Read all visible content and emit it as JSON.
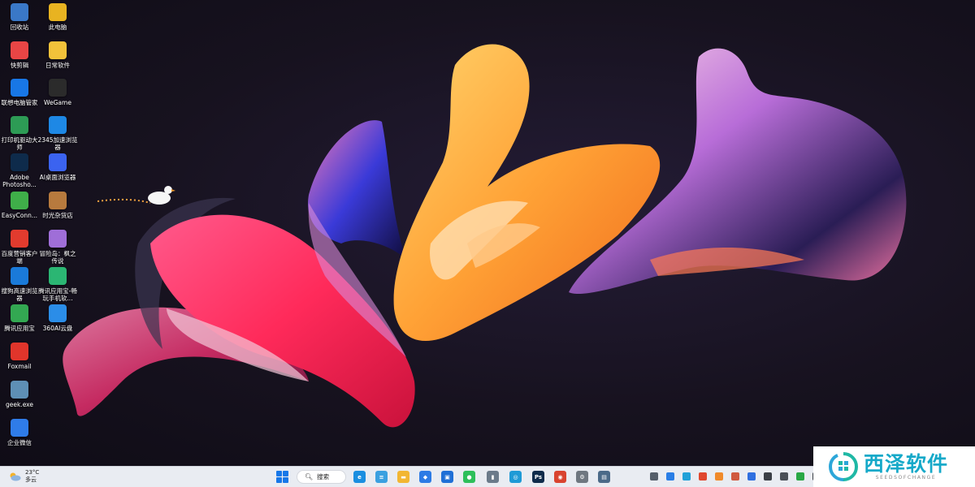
{
  "desktop_icons": [
    {
      "label": "回收站",
      "icon": "recycle-bin-icon",
      "color": "#3a78c7"
    },
    {
      "label": "此电脑",
      "icon": "this-pc-icon",
      "color": "#e8b321"
    },
    {
      "label": "快剪辑",
      "icon": "kuaijianji-icon",
      "color": "#e84545"
    },
    {
      "label": "日常软件",
      "icon": "folder-icon",
      "color": "#f2c23a"
    },
    {
      "label": "联想电脑管家",
      "icon": "lenovo-manager-icon",
      "color": "#1877e6"
    },
    {
      "label": "WeGame",
      "icon": "wegame-icon",
      "color": "#2b2b2b"
    },
    {
      "label": "打印机驱动大师",
      "icon": "printer-driver-icon",
      "color": "#2d9b55"
    },
    {
      "label": "2345加速浏览器",
      "icon": "2345-browser-icon",
      "color": "#1e88e5"
    },
    {
      "label": "Adobe Photosho...",
      "icon": "photoshop-icon",
      "color": "#0e2b4b"
    },
    {
      "label": "AI桌面浏览器",
      "icon": "ai-browser-icon",
      "color": "#3b63f0"
    },
    {
      "label": "EasyConn...",
      "icon": "easyconnect-icon",
      "color": "#3fae49"
    },
    {
      "label": "时光杂货店",
      "icon": "game-store-icon",
      "color": "#b77a3e"
    },
    {
      "label": "百度营销客户端",
      "icon": "baidu-marketing-icon",
      "color": "#e23b2e"
    },
    {
      "label": "冒险岛：枫之传说",
      "icon": "maplestory-icon",
      "color": "#9f6ed8"
    },
    {
      "label": "搜狗高速浏览器",
      "icon": "sogou-browser-icon",
      "color": "#1a7ad9"
    },
    {
      "label": "腾讯应用宝-畅玩手机软...",
      "icon": "tencent-appstore-icon",
      "color": "#2bb673"
    },
    {
      "label": "腾讯应用宝",
      "icon": "tencent-myapp-icon",
      "color": "#33a852"
    },
    {
      "label": "360AI云盘",
      "icon": "360-cloud-icon",
      "color": "#2b8de8"
    },
    {
      "label": "Foxmail",
      "icon": "foxmail-icon",
      "color": "#e0352b"
    },
    {
      "label": "geek.exe",
      "icon": "geek-icon",
      "color": "#5e8fb5"
    },
    {
      "label": "企业微信",
      "icon": "wecom-icon",
      "color": "#2f7ce8"
    }
  ],
  "taskbar": {
    "weather": {
      "temp": "23°C",
      "desc": "多云"
    },
    "search_label": "搜索",
    "apps": [
      {
        "name": "edge-browser-icon",
        "color": "#1a8ee0",
        "glyph": "e"
      },
      {
        "name": "notepad-icon",
        "color": "#3aa0e0",
        "glyph": "≡"
      },
      {
        "name": "file-explorer-icon",
        "color": "#f2b632",
        "glyph": "▬"
      },
      {
        "name": "app-store-icon",
        "color": "#2c7be5",
        "glyph": "◆"
      },
      {
        "name": "app-blue-icon",
        "color": "#1f6fd6",
        "glyph": "▣"
      },
      {
        "name": "wechat-icon",
        "color": "#2dbf5a",
        "glyph": "●"
      },
      {
        "name": "disk-tool-icon",
        "color": "#6b7a8a",
        "glyph": "▮"
      },
      {
        "name": "app-cyan-icon",
        "color": "#1e9ad6",
        "glyph": "◎"
      },
      {
        "name": "photoshop-icon",
        "color": "#0e2b4b",
        "glyph": "Ps"
      },
      {
        "name": "chrome-icon",
        "color": "#d9432f",
        "glyph": "◉"
      },
      {
        "name": "settings-gear-icon",
        "color": "#6f7780",
        "glyph": "⚙"
      },
      {
        "name": "screenshot-tool-icon",
        "color": "#4b6a88",
        "glyph": "▤"
      }
    ],
    "tray": [
      {
        "name": "tray-ime-icon",
        "color": "#555e6a"
      },
      {
        "name": "tray-app-blue-icon",
        "color": "#2a7ee6"
      },
      {
        "name": "tray-app-cyan-icon",
        "color": "#21a1d8"
      },
      {
        "name": "tray-ime-cn-icon",
        "color": "#e0472e"
      },
      {
        "name": "tray-orange-icon",
        "color": "#f08a2a"
      },
      {
        "name": "tray-avatar-icon",
        "color": "#d05a40"
      },
      {
        "name": "tray-app-blue2-icon",
        "color": "#2f6fe0"
      },
      {
        "name": "tray-music-icon",
        "color": "#3b3f46"
      },
      {
        "name": "tray-cloud-icon",
        "color": "#4a4f57"
      },
      {
        "name": "tray-green-icon",
        "color": "#29a845"
      },
      {
        "name": "tray-wifi-icon",
        "color": "#3a3f46"
      }
    ]
  },
  "watermark": {
    "title": "西泽软件",
    "subtitle": "SEEDSOFCHANGE"
  }
}
